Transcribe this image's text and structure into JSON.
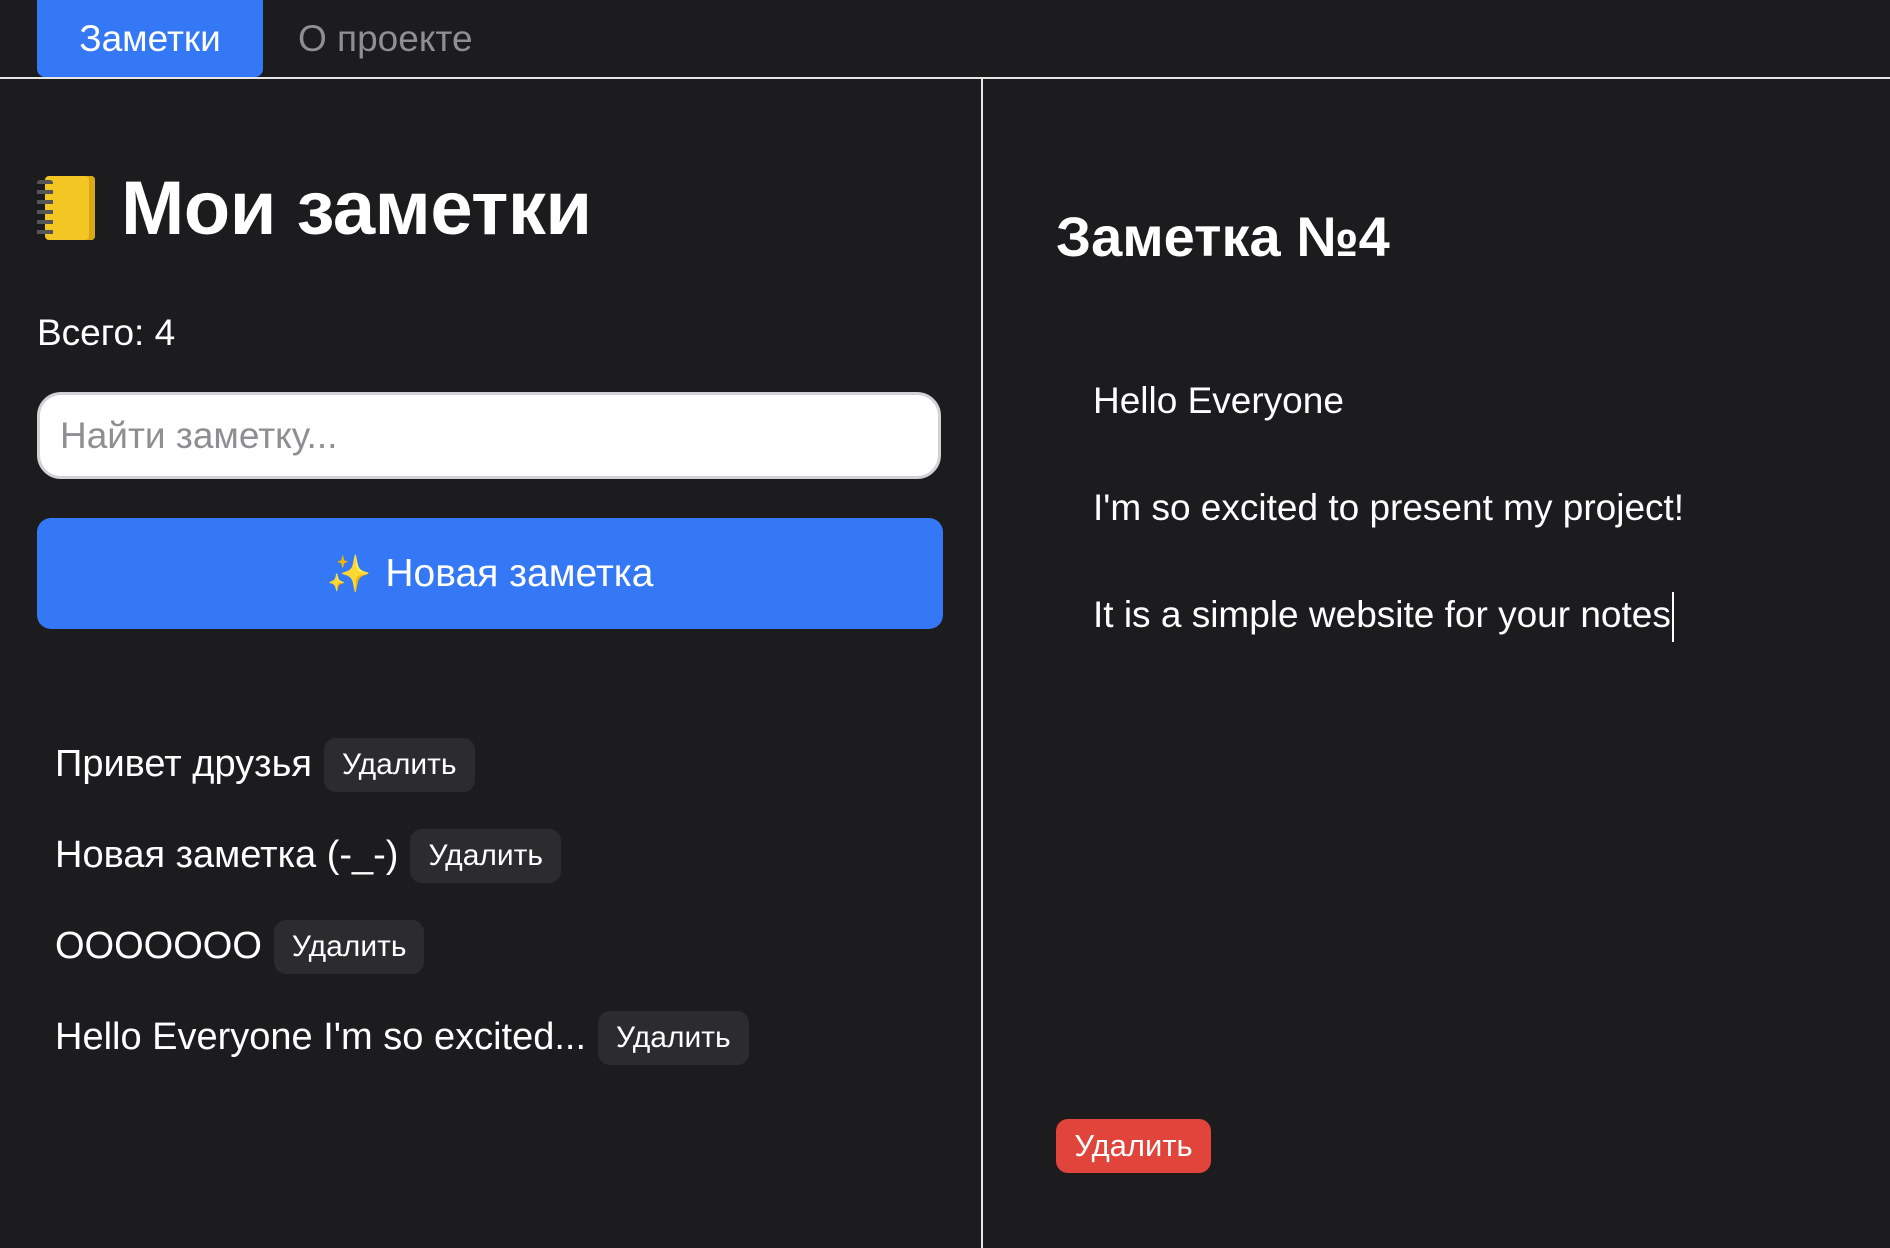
{
  "nav": {
    "tabs": [
      {
        "label": "Заметки",
        "active": true
      },
      {
        "label": "О проекте",
        "active": false
      }
    ]
  },
  "sidebar": {
    "icon": "notebook-icon",
    "title": "Мои заметки",
    "count_label": "Всего: 4",
    "search_placeholder": "Найти заметку...",
    "new_note_icon": "sparkles-icon",
    "new_note_label": "Новая заметка",
    "notes": [
      {
        "title": "Привет друзья",
        "delete_label": "Удалить"
      },
      {
        "title": "Новая заметка (-_-)",
        "delete_label": "Удалить"
      },
      {
        "title": "ОOOOOOO",
        "delete_label": "Удалить"
      },
      {
        "title": "Hello Everyone I'm so excited...",
        "delete_label": "Удалить"
      }
    ]
  },
  "editor": {
    "heading": "Заметка №4",
    "lines": [
      "Hello Everyone",
      "I'm so excited to present my project!",
      "It is a simple website for your notes"
    ],
    "delete_label": "Удалить"
  },
  "colors": {
    "background": "#1c1c1e",
    "accent": "#3478f6",
    "danger": "#e0443a",
    "chip": "#2c2c2e"
  }
}
